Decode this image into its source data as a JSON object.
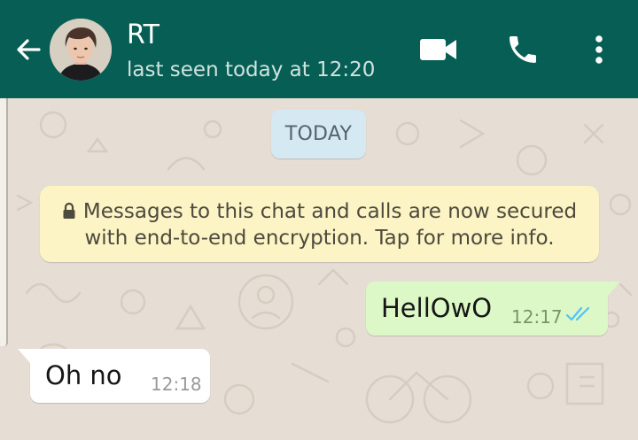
{
  "header": {
    "contact_name": "RT",
    "status": "last seen today at 12:20",
    "color": "#075e54"
  },
  "icons": {
    "back": "arrow-left-icon",
    "video": "video-camera-icon",
    "call": "phone-icon",
    "menu": "more-vertical-icon",
    "lock": "lock-icon",
    "ticks": "double-check-icon"
  },
  "chat": {
    "date_label": "TODAY",
    "encryption_notice": "Messages to this chat and calls are now secured with end-to-end encryption. Tap for more info.",
    "messages": [
      {
        "direction": "outgoing",
        "text": "HellOwO",
        "time": "12:17",
        "status": "read"
      },
      {
        "direction": "incoming",
        "text": "Oh no",
        "time": "12:18"
      }
    ]
  },
  "colors": {
    "outgoing_bubble": "#dcf8c6",
    "incoming_bubble": "#ffffff",
    "date_chip": "#d5e9f3",
    "notice": "#fcf4c4",
    "read_ticks": "#4fc3f7",
    "chat_background": "#e6ddd4"
  }
}
